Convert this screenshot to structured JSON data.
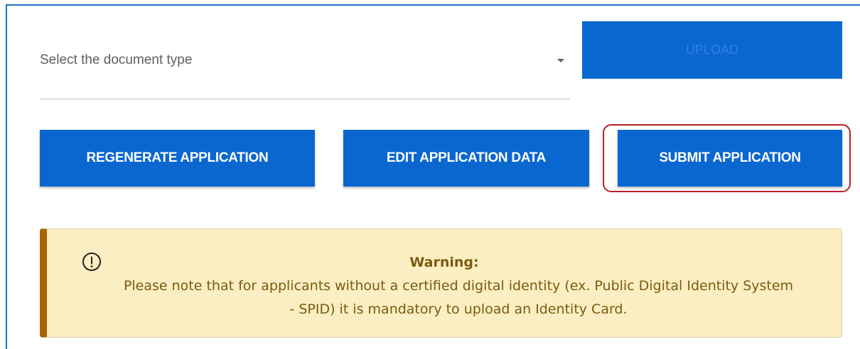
{
  "form": {
    "document_select": {
      "placeholder": "Select the document type"
    },
    "upload_label": "UPLOAD"
  },
  "actions": {
    "regenerate_label": "REGENERATE APPLICATION",
    "edit_label": "EDIT APPLICATION DATA",
    "submit_label": "SUBMIT APPLICATION"
  },
  "warning": {
    "title": "Warning:",
    "line1": "Please note that for applicants without a certified digital identity (ex. Public Digital Identity System",
    "line2": "- SPID) it is mandatory to upload an Identity Card.",
    "icon": "exclamation-circle-icon"
  },
  "colors": {
    "primary": "#0b67d0",
    "frame": "#1b73c6",
    "highlight": "#b3202a",
    "warning_bg": "#fbeec2",
    "warning_border": "#a86200",
    "warning_text": "#7a5b10"
  }
}
